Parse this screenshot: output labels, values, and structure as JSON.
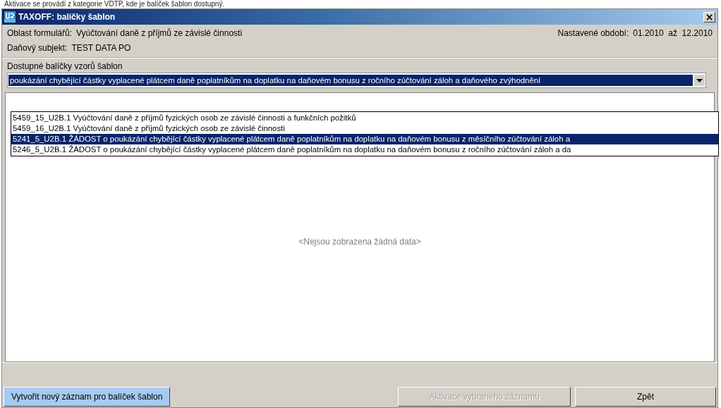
{
  "page_caption": "Aktivace se provádí z kategorie VDTP, kde je balíček šablon dostupný.",
  "window": {
    "title": "TAXOFF: balíčky šablon",
    "close": "×"
  },
  "info": {
    "form_area_label": "Oblast formulářů:",
    "form_area_value": "Vyúčtování daně z příjmů ze závislé činnosti",
    "period_label": "Nastavené období:",
    "period_value": "01.2010  až  12.2010",
    "subject_label": "Daňový subjekt:",
    "subject_value": "TEST DATA PO"
  },
  "packages": {
    "label": "Dostupné balíčky vzorů šablon",
    "value": "poukázání chybějící částky vyplacené plátcem daně poplatníkům na doplatku na daňovém bonusu z ročního zúčtování záloh a daňového zvýhodnění",
    "expanded": true,
    "options": [
      {
        "label": "5459_15_U2B.1 Vyúčtování daně z příjmů fyzických osob ze závislé činnosti a funkčních požitků",
        "selected": false
      },
      {
        "label": "5459_16_U2B.1 Vyúčtování daně z příjmů fyzických osob ze závislé činnosti",
        "selected": false
      },
      {
        "label": "5241_5_U2B.1 ŽÁDOST o poukázání chybějící částky vyplacené plátcem daně poplatníkům na doplatku na daňovém bonusu z měsíčního zúčtování záloh a",
        "selected": true
      },
      {
        "label": "5246_5_U2B.1 ŽÁDOST o poukázání chybějící částky vyplacené plátcem daně poplatníkům na doplatku na daňovém bonusu z ročního zúčtování záloh a da",
        "selected": false
      }
    ]
  },
  "grid": {
    "empty_text": "<Nejsou zobrazena žádná data>"
  },
  "buttons": [
    {
      "label": "Vytvořit nový záznam pro balíček šablon",
      "kind": "highlight",
      "disabled": false
    },
    {
      "label": "Aktivace vybraného záznamu",
      "kind": "normal",
      "disabled": true
    },
    {
      "label": "Zpět",
      "kind": "normal",
      "disabled": false
    }
  ]
}
